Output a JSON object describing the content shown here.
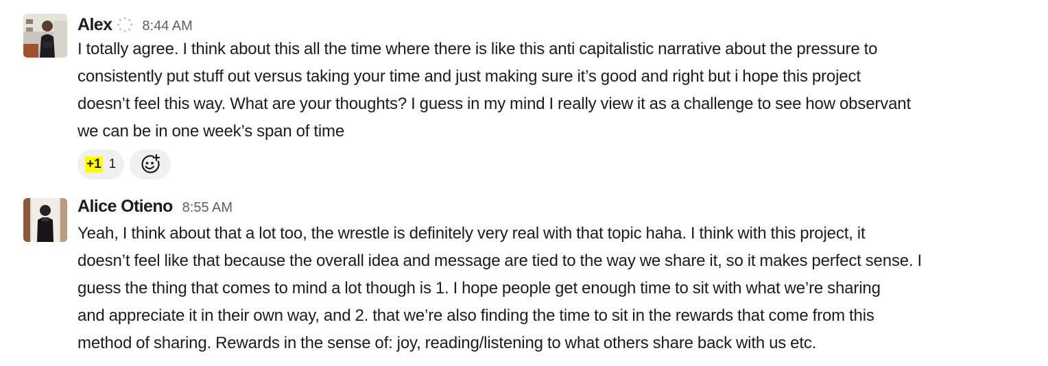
{
  "messages": [
    {
      "sender": "Alex",
      "timestamp": "8:44 AM",
      "status_icon": "status-loading-icon",
      "lines": [
        "I totally agree. I think about this all the time where there is like this anti capitalistic narrative about the pressure to",
        "consistently put stuff out versus taking your time and just making sure it’s good and right but i hope this project",
        "doesn’t feel this way. What are your thoughts? I guess in my mind I really view it as a challenge to see how observant",
        "we can be in one week’s span of time"
      ],
      "reactions": [
        {
          "emoji": "+1",
          "count": "1"
        }
      ]
    },
    {
      "sender": "Alice Otieno",
      "timestamp": "8:55 AM",
      "lines": [
        "Yeah, I think about that a lot too, the wrestle is definitely very real with that topic haha. I think with this project, it",
        "doesn’t feel like that because the overall idea and message are tied to the way we share it, so it makes perfect sense. I",
        "guess the thing that comes to mind a lot though is 1. I hope people get enough time to sit with what we’re sharing",
        "and appreciate it in their own way, and 2. that we’re also finding the time to sit in the rewards that come from this",
        "method of sharing. Rewards in the sense of: joy, reading/listening to what others share back with us etc."
      ]
    }
  ],
  "colors": {
    "reaction_bg": "#f0f0f0",
    "plus1_highlight": "#ffff00",
    "timestamp": "#616061",
    "text": "#1d1c1d"
  },
  "icons": {
    "add_reaction": "add-reaction-icon"
  }
}
